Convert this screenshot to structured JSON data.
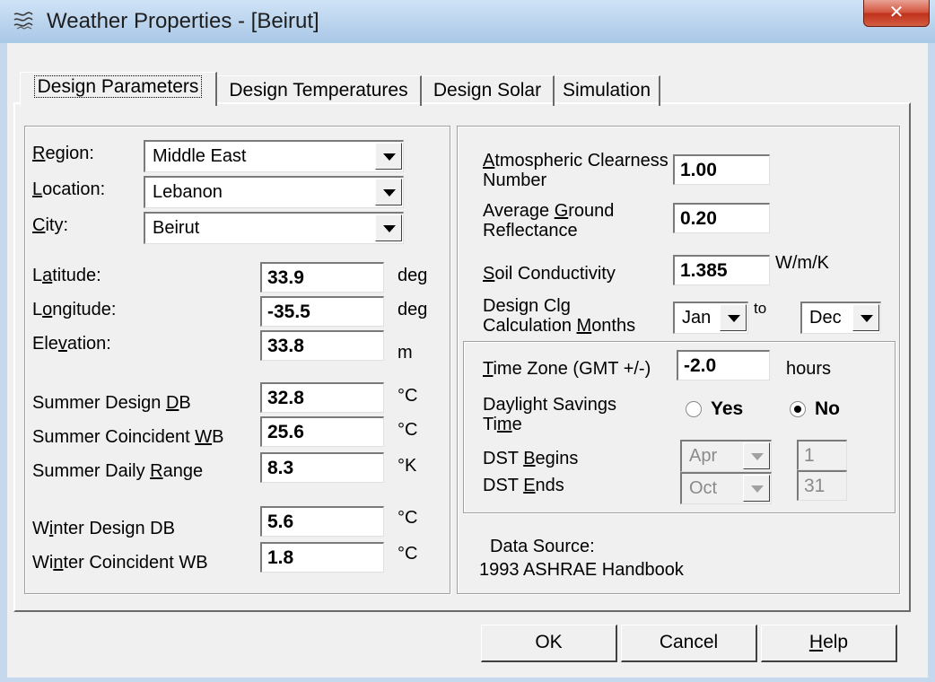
{
  "window": {
    "title": "Weather Properties - [Beirut]"
  },
  "tabs": [
    {
      "pre": "Desi",
      "key": "g",
      "post": "n Parameters"
    },
    {
      "pre": "Design Temperatures",
      "key": "",
      "post": ""
    },
    {
      "pre": "Design Solar",
      "key": "",
      "post": ""
    },
    {
      "pre": "Simulation",
      "key": "",
      "post": ""
    }
  ],
  "location": {
    "region": {
      "key": "R",
      "rest": "egion:",
      "value": "Middle East"
    },
    "location": {
      "key": "L",
      "rest": "ocation:",
      "value": "Lebanon"
    },
    "city": {
      "key": "C",
      "rest": "ity:",
      "value": "Beirut"
    }
  },
  "coords": {
    "latitude": {
      "pre": "L",
      "key": "a",
      "post": "titude:",
      "value": "33.9",
      "unit": "deg"
    },
    "longitude": {
      "pre": "L",
      "key": "o",
      "post": "ngitude:",
      "value": "-35.5",
      "unit": "deg"
    },
    "elevation": {
      "pre": "Ele",
      "key": "v",
      "post": "ation:",
      "value": "33.8",
      "unit": "m"
    }
  },
  "summer": {
    "design_db": {
      "pre": "Summer Design ",
      "key": "D",
      "post": "B",
      "value": "32.8",
      "unit": "°C"
    },
    "coincident_wb": {
      "pre": "Summer Coincident ",
      "key": "W",
      "post": "B",
      "value": "25.6",
      "unit": "°C"
    },
    "daily_range": {
      "pre": "Summer Daily ",
      "key": "R",
      "post": "ange",
      "value": "8.3",
      "unit": "°K"
    }
  },
  "winter": {
    "design_db": {
      "pre": "W",
      "key": "i",
      "post": "nter Design DB",
      "value": "5.6",
      "unit": "°C"
    },
    "coincident_wb": {
      "pre": "Wi",
      "key": "n",
      "post": "ter Coincident WB",
      "value": "1.8",
      "unit": "°C"
    }
  },
  "right": {
    "clearness": {
      "key": "A",
      "line1_rest": "tmospheric Clearness",
      "line2": "Number",
      "value": "1.00"
    },
    "reflectance": {
      "line1_pre": "Average ",
      "key": "G",
      "line1_post": "round",
      "line2": "Reflectance",
      "value": "0.20"
    },
    "soil": {
      "key": "S",
      "rest": "oil Conductivity",
      "value": "1.385",
      "unit": "W/m/K"
    },
    "months": {
      "line1": "Design Clg",
      "line2_pre": "Calculation ",
      "key": "M",
      "line2_post": "onths",
      "from": "Jan",
      "to_label": "to",
      "to": "Dec"
    }
  },
  "timezone": {
    "label": {
      "key": "T",
      "rest": "ime Zone (GMT +/-)"
    },
    "value": "-2.0",
    "unit": "hours",
    "dst": {
      "line1": "Daylight Savings",
      "line2_pre": "Ti",
      "key": "m",
      "line2_post": "e",
      "yes": "Yes",
      "no": "No",
      "selected": "No"
    },
    "begins": {
      "pre": "DST ",
      "key": "B",
      "post": "egins",
      "month": "Apr",
      "day": "1"
    },
    "ends": {
      "pre": "DST ",
      "key": "E",
      "post": "nds",
      "month": "Oct",
      "day": "31"
    }
  },
  "data_source": {
    "label": "Data Source:",
    "value": "1993 ASHRAE Handbook"
  },
  "buttons": {
    "ok": "OK",
    "cancel": "Cancel",
    "help": {
      "key": "H",
      "rest": "elp"
    }
  }
}
